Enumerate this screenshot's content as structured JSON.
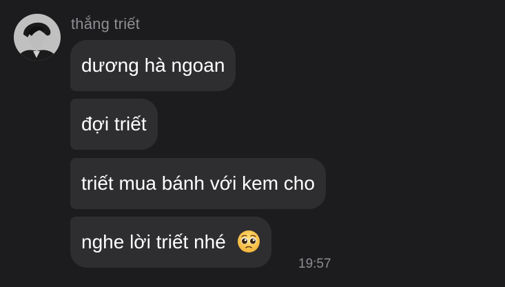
{
  "conversation": {
    "sender_name": "thắng triết",
    "messages": [
      {
        "text": "dương hà ngoan"
      },
      {
        "text": "đợi triết"
      },
      {
        "text": "triết mua bánh với kem cho"
      },
      {
        "text": "nghe lời triết nhé",
        "emoji": "pleading-face"
      }
    ],
    "last_timestamp": "19:57"
  },
  "colors": {
    "background": "#1c1c1e",
    "bubble": "#2e2e31",
    "text": "#ffffff",
    "muted": "#8e8e93"
  }
}
